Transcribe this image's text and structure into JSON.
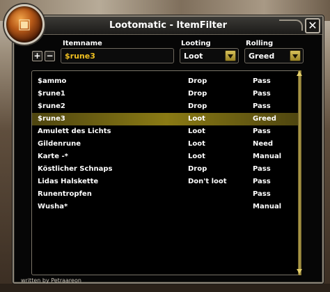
{
  "window": {
    "title": "Lootomatic - ItemFilter",
    "close_glyph": "✕",
    "emblem_icon": "treasure-chest-icon"
  },
  "form": {
    "itemname_label": "Itemname",
    "looting_label": "Looting",
    "rolling_label": "Rolling",
    "add_glyph": "+",
    "remove_glyph": "−",
    "itemname_value": "$rune3",
    "looting_value": "Loot",
    "rolling_value": "Greed"
  },
  "list": {
    "selected_index": 3,
    "rows": [
      {
        "name": "$ammo",
        "looting": "Drop",
        "rolling": "Pass"
      },
      {
        "name": "$rune1",
        "looting": "Drop",
        "rolling": "Pass"
      },
      {
        "name": "$rune2",
        "looting": "Drop",
        "rolling": "Pass"
      },
      {
        "name": "$rune3",
        "looting": "Loot",
        "rolling": "Greed"
      },
      {
        "name": "Amulett des Lichts",
        "looting": "Loot",
        "rolling": "Pass"
      },
      {
        "name": "Gildenrune",
        "looting": "Loot",
        "rolling": "Need"
      },
      {
        "name": "Karte -*",
        "looting": "Loot",
        "rolling": "Manual"
      },
      {
        "name": "Köstlicher Schnaps",
        "looting": "Drop",
        "rolling": "Pass"
      },
      {
        "name": "Lidas Halskette",
        "looting": "Don't loot",
        "rolling": "Pass"
      },
      {
        "name": "Runentropfen",
        "looting": "",
        "rolling": "Pass"
      },
      {
        "name": "Wusha*",
        "looting": "",
        "rolling": "Manual"
      }
    ]
  },
  "footer": {
    "text": "written by Petraareon"
  },
  "colors": {
    "accent_gold": "#f0c020",
    "selected_row": "#8a7a14",
    "text": "#ffffff"
  }
}
